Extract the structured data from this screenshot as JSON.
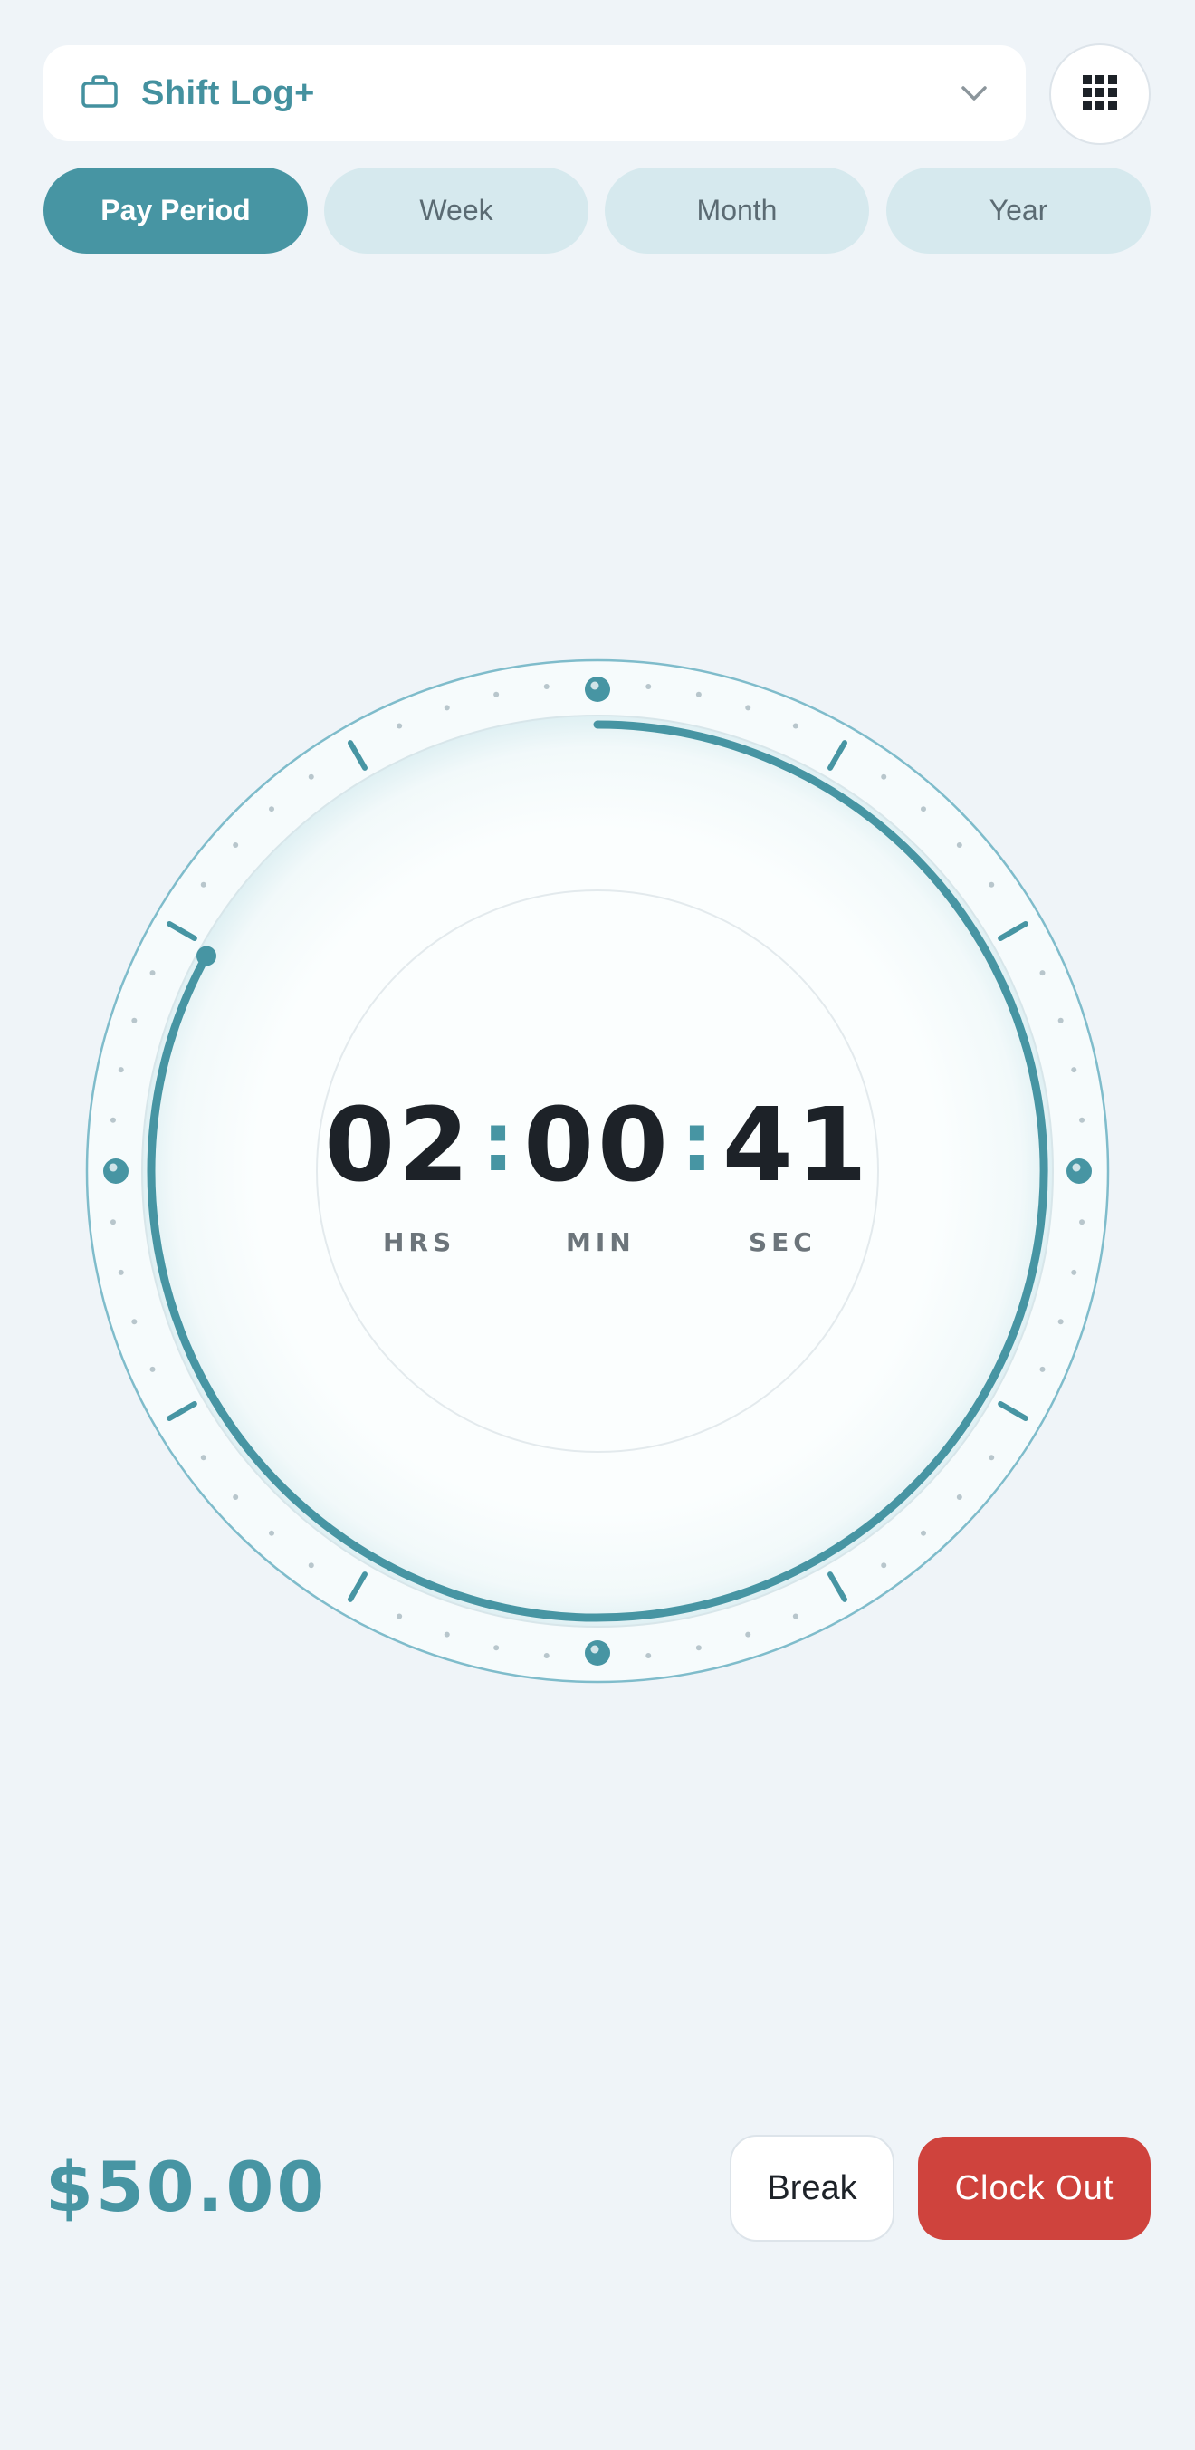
{
  "header": {
    "title": "Shift Log+",
    "icon": "briefcase-icon",
    "dropdown_icon": "chevron-down-icon",
    "apps_icon": "grid-icon"
  },
  "tabs": [
    {
      "label": "Pay Period",
      "active": true
    },
    {
      "label": "Week",
      "active": false
    },
    {
      "label": "Month",
      "active": false
    },
    {
      "label": "Year",
      "active": false
    }
  ],
  "timer": {
    "hours": "02",
    "minutes": "00",
    "seconds": "41",
    "hours_label": "HRS",
    "minutes_label": "MIN",
    "seconds_label": "SEC",
    "progress_fraction": 0.83
  },
  "earnings": "$50.00",
  "actions": {
    "break_label": "Break",
    "clock_out_label": "Clock Out"
  },
  "colors": {
    "accent": "#4795a3",
    "background": "#eff4f8",
    "tab_inactive": "#d6e9ee",
    "danger": "#cf433d",
    "text_dark": "#1d2228"
  }
}
